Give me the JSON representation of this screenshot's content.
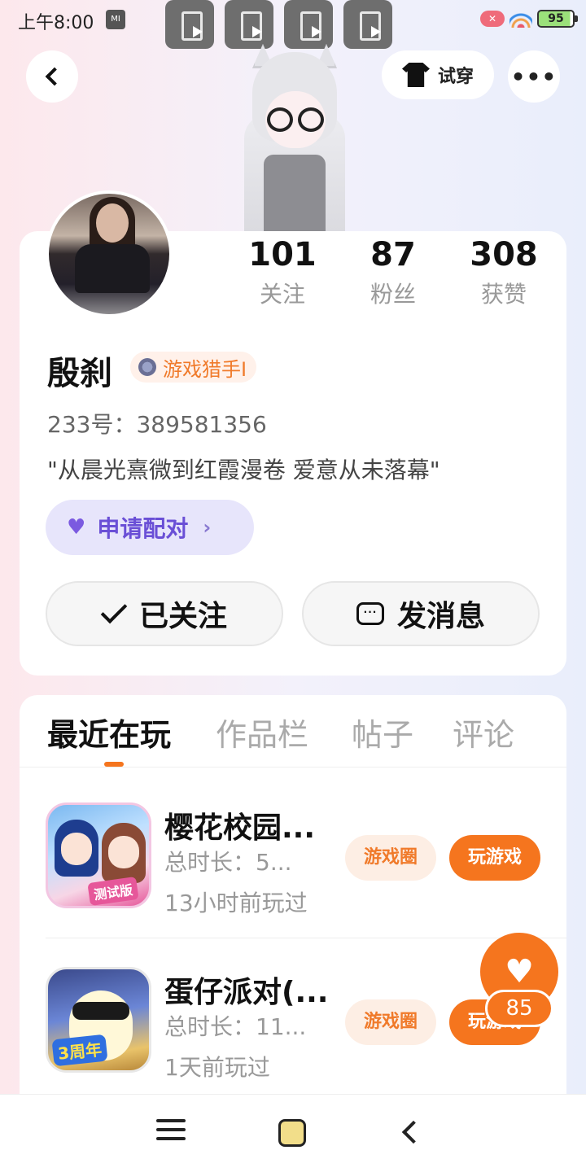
{
  "status_bar": {
    "time": "上午8:00",
    "mi_badge": "MI",
    "battery": "95"
  },
  "header": {
    "try_on_label": "试穿",
    "more_label": "•••"
  },
  "profile": {
    "stats": [
      {
        "value": "101",
        "label": "关注"
      },
      {
        "value": "87",
        "label": "粉丝"
      },
      {
        "value": "308",
        "label": "获赞"
      }
    ],
    "username": "殷刹",
    "title_badge": "游戏猎手I",
    "uid": "233号：389581356",
    "bio": "\"从晨光熹微到红霞漫卷 爱意从未落幕\"",
    "match_label": "申请配对",
    "follow_label": "已关注",
    "message_label": "发消息"
  },
  "tabs": [
    {
      "label": "最近在玩",
      "active": true
    },
    {
      "label": "作品栏",
      "active": false
    },
    {
      "label": "帖子",
      "active": false
    },
    {
      "label": "评论",
      "active": false
    }
  ],
  "games": [
    {
      "name": "樱花校园...",
      "duration": "总时长：5...",
      "last_played": "13小时前玩过",
      "circle_label": "游戏圈",
      "play_label": "玩游戏",
      "icon_text": "测试版"
    },
    {
      "name": "蛋仔派对(...",
      "duration": "总时长：11...",
      "last_played": "1天前玩过",
      "circle_label": "游戏圈",
      "play_label": "玩游戏",
      "icon_text": "3周年"
    }
  ],
  "like_fab": {
    "count": "85"
  },
  "colors": {
    "accent": "#f5751e",
    "match_purple": "#6a4fd6"
  }
}
